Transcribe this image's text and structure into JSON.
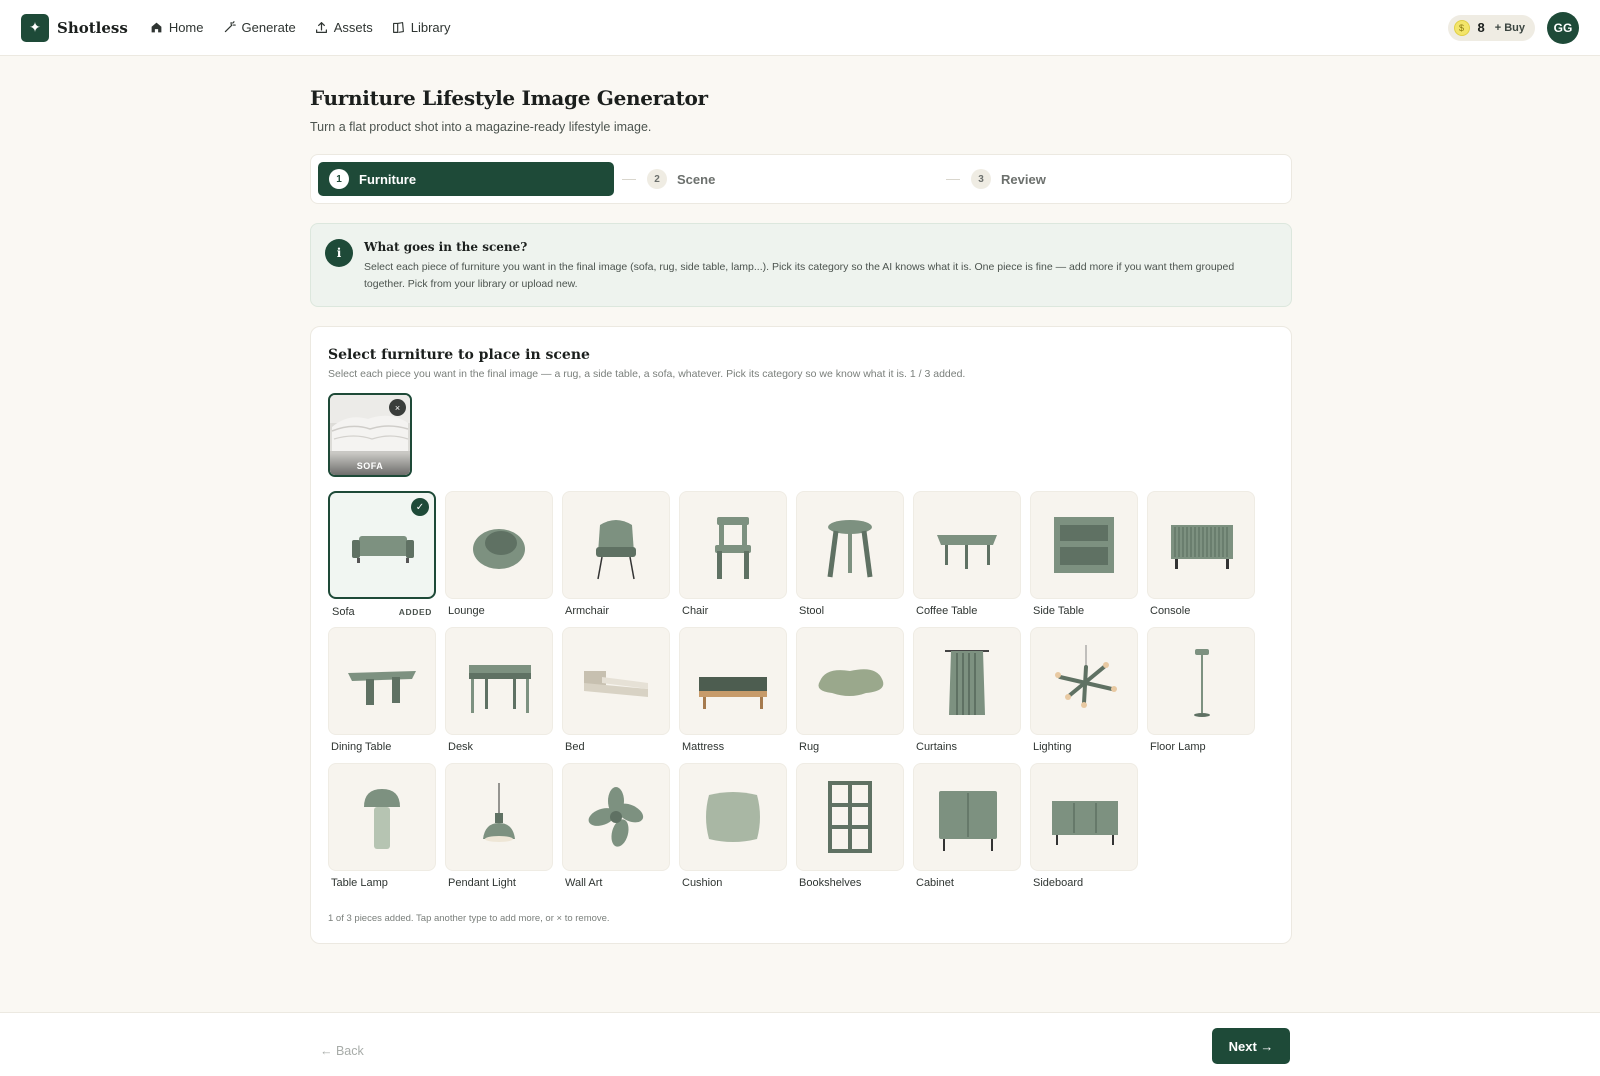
{
  "nav": {
    "brand": "Shotless",
    "brand_icon": "sparkle-icon",
    "items": [
      {
        "label": "Home",
        "icon": "home-icon"
      },
      {
        "label": "Generate",
        "icon": "wand-icon"
      },
      {
        "label": "Assets",
        "icon": "upload-icon"
      },
      {
        "label": "Library",
        "icon": "book-icon"
      }
    ],
    "credits": "8",
    "buy_label": "+ Buy",
    "avatar_initials": "GG"
  },
  "header": {
    "title": "Furniture Lifestyle Image Generator",
    "subtitle": "Turn a flat product shot into a magazine-ready lifestyle image."
  },
  "stepper": {
    "steps": [
      {
        "num": "1",
        "label": "Furniture",
        "active": true
      },
      {
        "num": "2",
        "label": "Scene",
        "active": false
      },
      {
        "num": "3",
        "label": "Review",
        "active": false
      }
    ]
  },
  "info": {
    "icon_label": "i",
    "title": "What goes in the scene?",
    "text": "Select each piece of furniture you want in the final image (sofa, rug, side table, lamp...). Pick its category so the AI knows what it is. One piece is fine — add more if you want them grouped together. Pick from your library or upload new."
  },
  "picker": {
    "title": "Select furniture to place in scene",
    "subtitle": "Select each piece you want in the final image — a rug, a side table, a sofa, whatever. Pick its category so we know what it is. 1 / 3 added.",
    "selected_thumb_label": "SOFA",
    "remove_glyph": "×",
    "check_glyph": "✓",
    "added_badge": "ADDED",
    "categories": [
      {
        "label": "Sofa",
        "icon": "sofa-icon",
        "selected": true
      },
      {
        "label": "Lounge",
        "icon": "lounge-chair-icon",
        "selected": false
      },
      {
        "label": "Armchair",
        "icon": "armchair-icon",
        "selected": false
      },
      {
        "label": "Chair",
        "icon": "chair-icon",
        "selected": false
      },
      {
        "label": "Stool",
        "icon": "stool-icon",
        "selected": false
      },
      {
        "label": "Coffee Table",
        "icon": "coffee-table-icon",
        "selected": false
      },
      {
        "label": "Side Table",
        "icon": "side-table-icon",
        "selected": false
      },
      {
        "label": "Console",
        "icon": "console-icon",
        "selected": false
      },
      {
        "label": "Dining Table",
        "icon": "dining-table-icon",
        "selected": false
      },
      {
        "label": "Desk",
        "icon": "desk-icon",
        "selected": false
      },
      {
        "label": "Bed",
        "icon": "bed-icon",
        "selected": false
      },
      {
        "label": "Mattress",
        "icon": "mattress-icon",
        "selected": false
      },
      {
        "label": "Rug",
        "icon": "rug-icon",
        "selected": false
      },
      {
        "label": "Curtains",
        "icon": "curtains-icon",
        "selected": false
      },
      {
        "label": "Lighting",
        "icon": "chandelier-icon",
        "selected": false
      },
      {
        "label": "Floor Lamp",
        "icon": "floor-lamp-icon",
        "selected": false
      },
      {
        "label": "Table Lamp",
        "icon": "table-lamp-icon",
        "selected": false
      },
      {
        "label": "Pendant Light",
        "icon": "pendant-light-icon",
        "selected": false
      },
      {
        "label": "Wall Art",
        "icon": "wall-art-icon",
        "selected": false
      },
      {
        "label": "Cushion",
        "icon": "cushion-icon",
        "selected": false
      },
      {
        "label": "Bookshelves",
        "icon": "bookshelves-icon",
        "selected": false
      },
      {
        "label": "Cabinet",
        "icon": "cabinet-icon",
        "selected": false
      },
      {
        "label": "Sideboard",
        "icon": "sideboard-icon",
        "selected": false
      }
    ],
    "footer": "1 of 3 pieces added. Tap another type to add more, or × to remove."
  },
  "footer_nav": {
    "back_label": "← Back",
    "next_label": "Next →"
  },
  "colors": {
    "accent": "#1e4a38",
    "furniture": "#7d9180",
    "background": "#faf8f3"
  }
}
